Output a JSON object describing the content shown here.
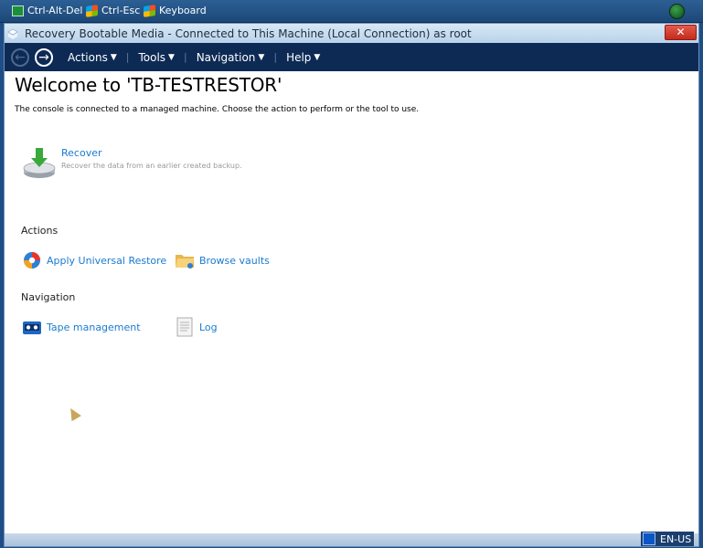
{
  "topbar": {
    "cad_label": "Ctrl-Alt-Del",
    "esc_label": "Ctrl-Esc",
    "keyboard_label": "Keyboard"
  },
  "window": {
    "title": "Recovery Bootable Media - Connected to This Machine (Local Connection) as root",
    "close_label": "✕"
  },
  "menubar": {
    "back_icon": "arrow-left-icon",
    "forward_icon": "arrow-right-icon",
    "items": [
      {
        "label": "Actions"
      },
      {
        "label": "Tools"
      },
      {
        "label": "Navigation"
      },
      {
        "label": "Help"
      }
    ]
  },
  "main": {
    "title": "Welcome to 'TB-TESTRESTOR'",
    "description": "The console is connected to a managed machine. Choose the action to perform or the tool to use.",
    "recover": {
      "label": "Recover",
      "description": "Recover the data from an earlier created backup."
    },
    "actions_heading": "Actions",
    "actions": [
      {
        "label": "Apply Universal Restore",
        "icon": "universal-restore-icon"
      },
      {
        "label": "Browse vaults",
        "icon": "folder-icon"
      }
    ],
    "navigation_heading": "Navigation",
    "navigation": [
      {
        "label": "Tape management",
        "icon": "tape-icon"
      },
      {
        "label": "Log",
        "icon": "log-icon"
      }
    ]
  },
  "statusbar": {
    "language": "EN-US"
  },
  "colors": {
    "menubar_bg": "#0d2a55",
    "link": "#1a7bd0",
    "titlebar": "#c8dcf0"
  }
}
